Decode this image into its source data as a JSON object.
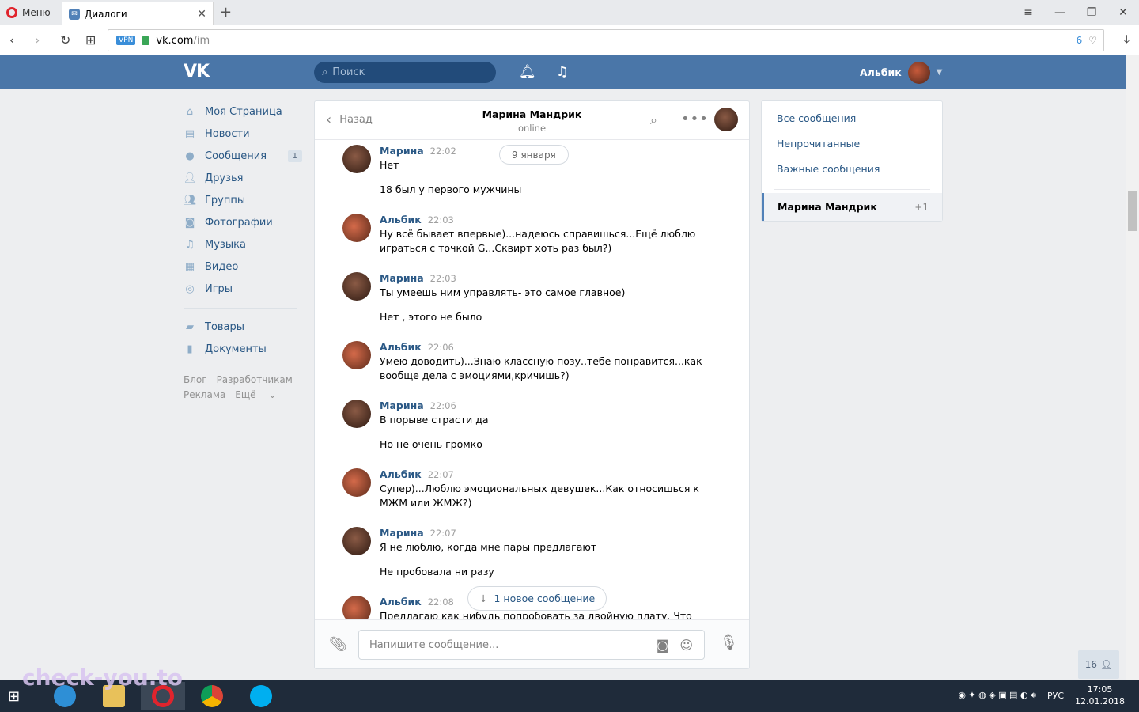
{
  "browser": {
    "menu_label": "Меню",
    "tab_title": "Диалоги",
    "url_host": "vk.com",
    "url_path": "/im",
    "vpn_label": "VPN",
    "badge_count": "6"
  },
  "header": {
    "search_placeholder": "Поиск",
    "user_name": "Альбик"
  },
  "nav": {
    "items": [
      {
        "label": "Моя Страница",
        "icon": "home-icon"
      },
      {
        "label": "Новости",
        "icon": "news-icon"
      },
      {
        "label": "Сообщения",
        "icon": "messages-icon",
        "badge": "1"
      },
      {
        "label": "Друзья",
        "icon": "friend-icon"
      },
      {
        "label": "Группы",
        "icon": "groups-icon"
      },
      {
        "label": "Фотографии",
        "icon": "camera-icon"
      },
      {
        "label": "Музыка",
        "icon": "music-icon"
      },
      {
        "label": "Видео",
        "icon": "video-icon"
      },
      {
        "label": "Игры",
        "icon": "gamepad-icon"
      }
    ],
    "items2": [
      {
        "label": "Товары",
        "icon": "bag-icon"
      },
      {
        "label": "Документы",
        "icon": "document-icon"
      }
    ],
    "footer": [
      "Блог",
      "Разработчикам",
      "Реклама",
      "Ещё"
    ]
  },
  "chat": {
    "back_label": "Назад",
    "peer_name": "Марина Мандрик",
    "peer_status": "online",
    "date_divider": "9 января",
    "messages": [
      {
        "author": "Марина",
        "time": "22:02",
        "lines": [
          "Нет",
          "",
          "18 был у первого мужчины"
        ]
      },
      {
        "author": "Альбик",
        "time": "22:03",
        "lines": [
          "Ну всё бывает впервые)...надеюсь справишься...Ещё люблю",
          "играться с точкой G...Сквирт хоть раз был?)"
        ]
      },
      {
        "author": "Марина",
        "time": "22:03",
        "lines": [
          "Ты умеешь ним управлять- это самое главное)",
          "",
          "Нет , этого не было"
        ]
      },
      {
        "author": "Альбик",
        "time": "22:06",
        "lines": [
          "Умею доводить)...Знаю классную позу..тебе понравится...как",
          "вообще дела с эмоциями,кричишь?)"
        ]
      },
      {
        "author": "Марина",
        "time": "22:06",
        "lines": [
          "В порыве страсти да",
          "",
          "Но не очень громко"
        ]
      },
      {
        "author": "Альбик",
        "time": "22:07",
        "lines": [
          "Супер)...Люблю эмоциональных девушек...Как относишься к",
          "МЖМ или ЖМЖ?)"
        ]
      },
      {
        "author": "Марина",
        "time": "22:07",
        "lines": [
          "Я не люблю, когда мне пары предлагают",
          "",
          "Не пробовала ни разу"
        ]
      },
      {
        "author": "Альбик",
        "time": "22:08",
        "lines": [
          "Предлагаю как нибудь попробовать за двойную плату. Что"
        ]
      }
    ],
    "new_message_label": "1 новое сообщение",
    "input_placeholder": "Напишите сообщение..."
  },
  "right_menu": {
    "items": [
      "Все сообщения",
      "Непрочитанные",
      "Важные сообщения"
    ],
    "active_label": "Марина Мандрик",
    "active_count": "+1"
  },
  "online_count": "16",
  "taskbar": {
    "lang": "РУС",
    "time": "17:05",
    "date": "12.01.2018"
  },
  "watermark": "check-you.to"
}
